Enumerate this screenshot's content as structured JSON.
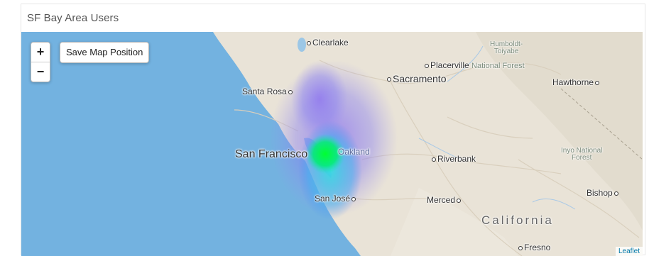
{
  "card": {
    "title": "SF Bay Area Users"
  },
  "map": {
    "zoom_in": "+",
    "zoom_out": "−",
    "save_position_label": "Save Map Position",
    "attribution": "Leaflet",
    "places": {
      "clearlake": "Clearlake",
      "humboldt_1": "Humboldt-",
      "humboldt_2": "Toiyabe",
      "humboldt_3": "National Forest",
      "placerville": "Placerville",
      "sacramento": "Sacramento",
      "hawthorne": "Hawthorne",
      "santa_rosa": "Santa Rosa",
      "san_francisco": "San Francisco",
      "oakland": "Oakland",
      "riverbank": "Riverbank",
      "inyo_1": "Inyo National",
      "inyo_2": "Forest",
      "san_jose": "San José",
      "merced": "Merced",
      "bishop": "Bishop",
      "california": "California",
      "fresno": "Fresno"
    },
    "colors": {
      "ocean": "#73b2e0",
      "land": "#e9e3d7",
      "heat_core": "#00f050",
      "heat_mid": "#40d8f0",
      "heat_outer": "#7080f0"
    }
  }
}
